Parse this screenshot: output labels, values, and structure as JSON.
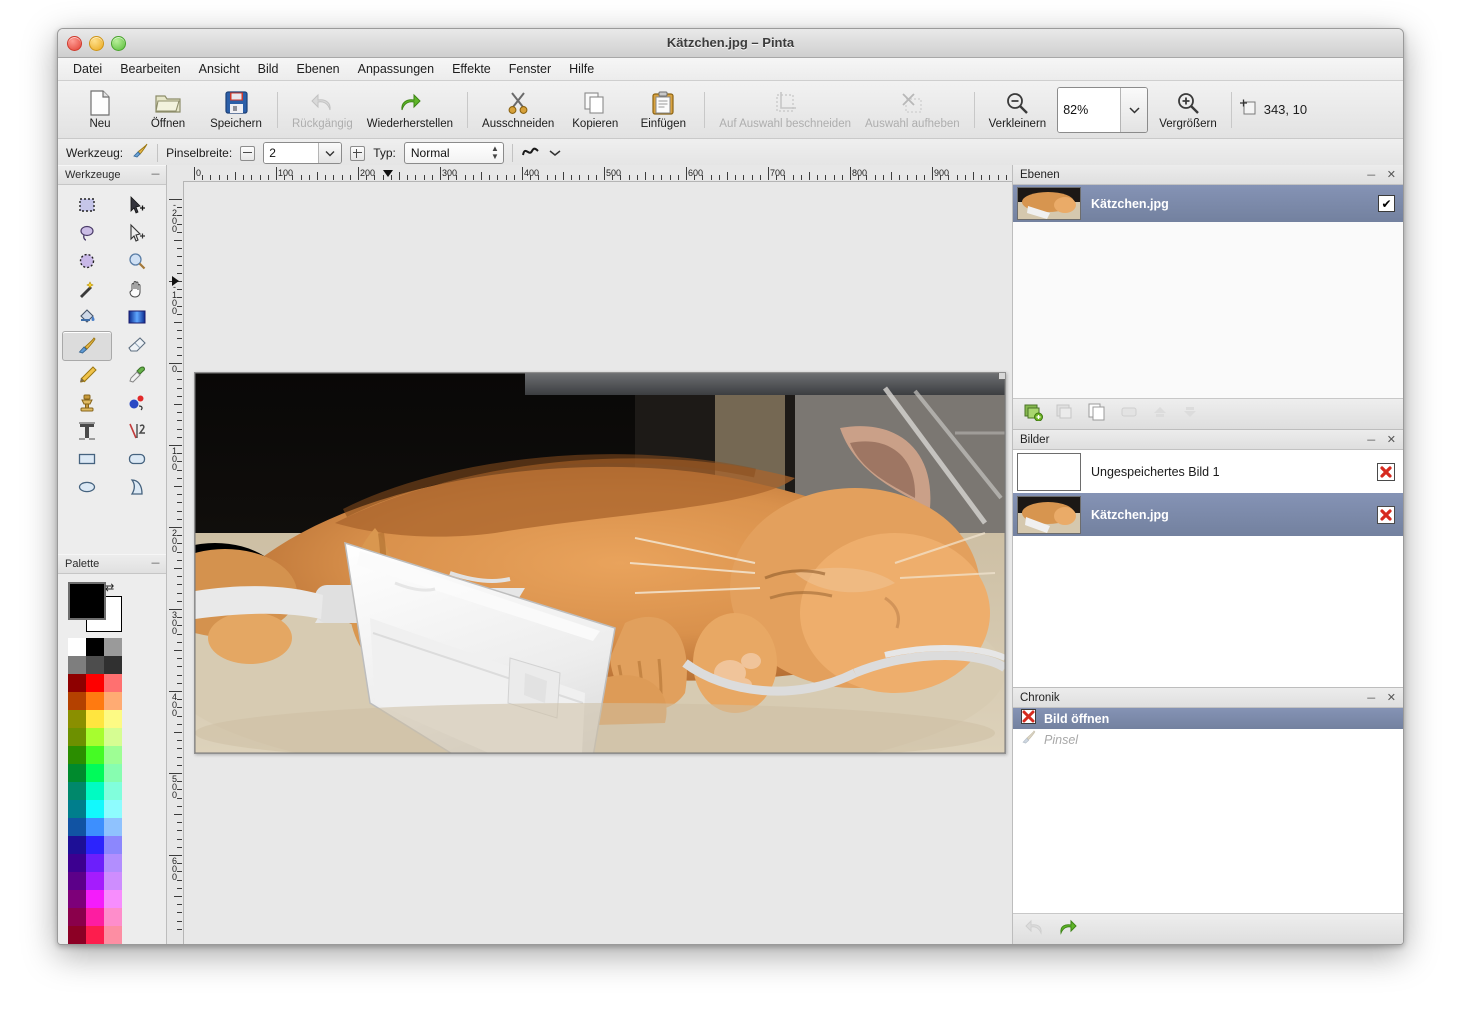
{
  "window": {
    "title": "Kätzchen.jpg – Pinta",
    "traffic_lights": [
      "close",
      "minimize",
      "maximize"
    ]
  },
  "menubar": {
    "items": [
      {
        "label": "Datei"
      },
      {
        "label": "Bearbeiten"
      },
      {
        "label": "Ansicht"
      },
      {
        "label": "Bild"
      },
      {
        "label": "Ebenen"
      },
      {
        "label": "Anpassungen"
      },
      {
        "label": "Effekte"
      },
      {
        "label": "Fenster"
      },
      {
        "label": "Hilfe"
      }
    ]
  },
  "toolbar": {
    "buttons": [
      {
        "label": "Neu",
        "icon": "new-document-icon",
        "disabled": false
      },
      {
        "label": "Öffnen",
        "icon": "open-folder-icon",
        "disabled": false
      },
      {
        "label": "Speichern",
        "icon": "floppy-disk-icon",
        "disabled": false
      },
      {
        "label": "Rückgängig",
        "icon": "undo-arrow-icon",
        "disabled": true
      },
      {
        "label": "Wiederherstellen",
        "icon": "redo-arrow-icon",
        "disabled": false
      },
      {
        "label": "Ausschneiden",
        "icon": "scissors-icon",
        "disabled": false
      },
      {
        "label": "Kopieren",
        "icon": "copy-pages-icon",
        "disabled": false
      },
      {
        "label": "Einfügen",
        "icon": "clipboard-paste-icon",
        "disabled": false
      },
      {
        "label": "Auf Auswahl beschneiden",
        "icon": "crop-to-selection-icon",
        "disabled": true
      },
      {
        "label": "Auswahl aufheben",
        "icon": "deselect-icon",
        "disabled": true
      },
      {
        "label": "Verkleinern",
        "icon": "zoom-out-icon",
        "disabled": false
      },
      {
        "label": "Vergrößern",
        "icon": "zoom-in-icon",
        "disabled": false
      }
    ],
    "zoom_value": "82%",
    "cursor_position": "343, 10",
    "cursor_icon": "cursor-position-icon"
  },
  "options_bar": {
    "tool_label": "Werkzeug:",
    "tool_icon": "paintbrush-icon",
    "brush_width_label": "Pinselbreite:",
    "brush_width_value": "2",
    "minus_icon": "minus-box-icon",
    "plus_icon": "plus-box-icon",
    "type_label": "Typ:",
    "type_value": "Normal",
    "stroke_icon": "stroke-curve-icon",
    "stroke_dropdown_icon": "chevron-down-icon"
  },
  "tools_panel": {
    "title": "Werkzeuge",
    "minimize_icon": "minimize-icon",
    "tools": [
      {
        "name": "rectangle-select-tool",
        "icon": "dotted-square-icon",
        "active": false
      },
      {
        "name": "move-selected-tool",
        "icon": "arrow-plus-icon",
        "active": false
      },
      {
        "name": "lasso-select-tool",
        "icon": "lasso-icon",
        "active": false
      },
      {
        "name": "move-selection-tool",
        "icon": "outline-arrow-plus-icon",
        "active": false
      },
      {
        "name": "ellipse-select-tool",
        "icon": "dotted-circle-icon",
        "active": false
      },
      {
        "name": "zoom-tool",
        "icon": "magnifier-icon",
        "active": false
      },
      {
        "name": "magic-wand-tool",
        "icon": "magic-wand-icon",
        "active": false
      },
      {
        "name": "pan-tool",
        "icon": "hand-icon",
        "active": false
      },
      {
        "name": "paint-bucket-tool",
        "icon": "paint-bucket-icon",
        "active": false
      },
      {
        "name": "gradient-tool",
        "icon": "gradient-icon",
        "active": false
      },
      {
        "name": "paintbrush-tool",
        "icon": "paintbrush-icon",
        "active": true
      },
      {
        "name": "eraser-tool",
        "icon": "eraser-icon",
        "active": false
      },
      {
        "name": "pencil-tool",
        "icon": "pencil-icon",
        "active": false
      },
      {
        "name": "color-picker-tool",
        "icon": "eyedropper-icon",
        "active": false
      },
      {
        "name": "clone-stamp-tool",
        "icon": "stamp-icon",
        "active": false
      },
      {
        "name": "recolor-tool",
        "icon": "recolor-dots-icon",
        "active": false
      },
      {
        "name": "text-tool",
        "icon": "text-t-icon",
        "active": false
      },
      {
        "name": "line-curve-tool",
        "icon": "line-curve-icon",
        "active": false
      },
      {
        "name": "rectangle-tool",
        "icon": "rectangle-icon",
        "active": false
      },
      {
        "name": "rounded-rectangle-tool",
        "icon": "rounded-rectangle-icon",
        "active": false
      },
      {
        "name": "ellipse-tool",
        "icon": "ellipse-icon",
        "active": false
      },
      {
        "name": "freeform-shape-tool",
        "icon": "freeform-shape-icon",
        "active": false
      }
    ]
  },
  "palette_panel": {
    "title": "Palette",
    "minimize_icon": "minimize-icon",
    "primary_color": "#000000",
    "secondary_color": "#ffffff",
    "swap_icon": "swap-colors-icon",
    "colors": [
      "#ffffff",
      "#000000",
      "#9a9a9a",
      "#7e7e7e",
      "#4d4d4d",
      "#303030",
      "#8e0000",
      "#fe0000",
      "#ff7070",
      "#b44100",
      "#ff7a10",
      "#ffab73",
      "#8a8f00",
      "#ffe53f",
      "#fdfa84",
      "#6d9000",
      "#a7fd2f",
      "#d6fd92",
      "#2b8d00",
      "#45fb24",
      "#9efe94",
      "#008a2d",
      "#00fb5a",
      "#87fdb0",
      "#00886b",
      "#00fbc2",
      "#81fedc",
      "#007e8c",
      "#12f9fd",
      "#8efcfe",
      "#1153a3",
      "#3d8ffe",
      "#8fc2fe",
      "#1d0f96",
      "#2c24fd",
      "#8c87fd",
      "#3c0090",
      "#6c1ffb",
      "#b28efe",
      "#5c0089",
      "#a51cfd",
      "#ce8dfe",
      "#7d0079",
      "#f41cfb",
      "#f78dfd",
      "#8a004b",
      "#fd1da1",
      "#fe8dcb",
      "#8c0025",
      "#fd1d4d",
      "#fd8ea3"
    ]
  },
  "rulers": {
    "horizontal_labels": [
      "0",
      "100",
      "200",
      "300",
      "400",
      "500",
      "600",
      "700",
      "800",
      "900"
    ],
    "vertical_labels": [
      "-200",
      "-100",
      "0",
      "100",
      "200",
      "300",
      "400",
      "500",
      "600"
    ],
    "horizontal_marker_position": "230",
    "vertical_marker_position": "-60"
  },
  "canvas": {
    "image_name": "Kätzchen.jpg",
    "image_alt": "sleeping orange tabby kitten resting on a white laptop power adapter on beige carpet"
  },
  "layers_panel": {
    "title": "Ebenen",
    "minimize_icon": "minimize-icon",
    "close_icon": "close-icon",
    "rows": [
      {
        "name": "Kätzchen.jpg",
        "visible": true,
        "selected": true,
        "thumb": "kitten"
      }
    ],
    "toolbar_icons": [
      {
        "name": "add-layer-icon",
        "disabled": false
      },
      {
        "name": "delete-layer-icon",
        "disabled": true
      },
      {
        "name": "duplicate-layer-icon",
        "disabled": false
      },
      {
        "name": "merge-layer-down-icon",
        "disabled": true
      },
      {
        "name": "move-layer-up-icon",
        "disabled": true
      },
      {
        "name": "move-layer-down-icon",
        "disabled": true
      }
    ]
  },
  "images_panel": {
    "title": "Bilder",
    "minimize_icon": "minimize-icon",
    "close_icon": "close-icon",
    "rows": [
      {
        "name": "Ungespeichertes Bild 1",
        "selected": false,
        "thumb": "blank",
        "close_icon": "close-red-icon"
      },
      {
        "name": "Kätzchen.jpg",
        "selected": true,
        "thumb": "kitten",
        "close_icon": "close-red-icon"
      }
    ]
  },
  "history_panel": {
    "title": "Chronik",
    "minimize_icon": "minimize-icon",
    "close_icon": "close-icon",
    "rows": [
      {
        "name": "Bild öffnen",
        "icon": "open-image-icon",
        "selected": true,
        "dimmed": false
      },
      {
        "name": "Pinsel",
        "icon": "paintbrush-icon",
        "selected": false,
        "dimmed": true
      }
    ],
    "toolbar_icons": [
      {
        "name": "history-undo-icon",
        "disabled": true
      },
      {
        "name": "history-redo-icon",
        "disabled": false
      }
    ]
  },
  "colors": {
    "selection_blue": "#73819f",
    "panel_bg": "#ededed",
    "canvas_bg": "#e8e8e8",
    "accent_green": "#5fb628",
    "accent_red": "#e03a2c"
  }
}
